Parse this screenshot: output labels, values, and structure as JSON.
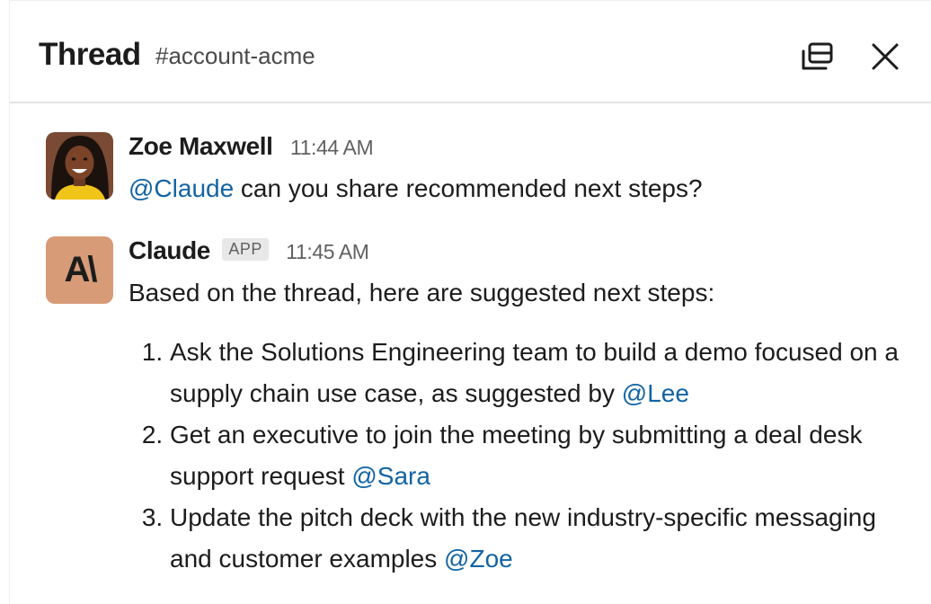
{
  "header": {
    "title": "Thread",
    "channel": "#account-acme"
  },
  "icons": {
    "popout": "popout-window-icon",
    "close": "close-icon"
  },
  "colors": {
    "mention": "#1264a3",
    "claude_avatar_bg": "#d79b77",
    "claude_avatar_fg": "#1d1c1d"
  },
  "messages": [
    {
      "author": "Zoe Maxwell",
      "time": "11:44 AM",
      "mention": "@Claude",
      "text": " can you share recommended next steps?"
    },
    {
      "author": "Claude",
      "badge": "APP",
      "time": "11:45 AM",
      "avatar_text": "A\\",
      "intro": "Based on the thread, here are suggested next steps:",
      "steps": [
        {
          "text": "Ask the Solutions Engineering team to build a demo focused on a supply chain use case, as suggested by ",
          "mention": "@Lee"
        },
        {
          "text": "Get an executive to join the meeting by submitting a deal desk support request ",
          "mention": "@Sara"
        },
        {
          "text": "Update the pitch deck with the new industry-specific messaging and customer examples ",
          "mention": "@Zoe"
        }
      ]
    }
  ]
}
